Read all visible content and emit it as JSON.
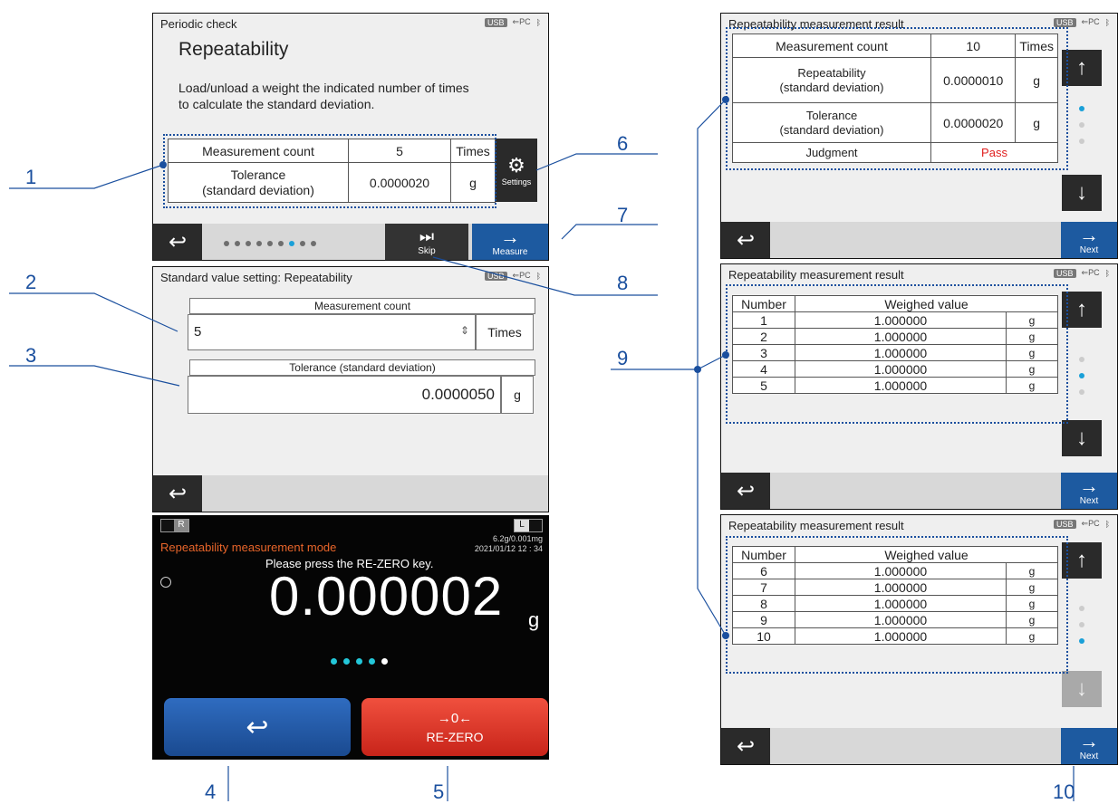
{
  "callouts": [
    "1",
    "2",
    "3",
    "4",
    "5",
    "6",
    "7",
    "8",
    "9",
    "10"
  ],
  "screen1": {
    "header": "Periodic check",
    "status": {
      "usb": "USB",
      "pc": "PC"
    },
    "title": "Repeatability",
    "desc_line1": "Load/unload a weight the indicated number of times",
    "desc_line2": "to calculate the standard deviation.",
    "rows": [
      {
        "label": "Measurement count",
        "value": "5",
        "unit": "Times"
      },
      {
        "label": "Tolerance\n(standard deviation)",
        "value": "0.0000020",
        "unit": "g"
      }
    ],
    "settings_label": "Settings",
    "skip_label": "Skip",
    "measure_label": "Measure"
  },
  "screen2": {
    "header": "Standard value setting: Repeatability",
    "count_label": "Measurement count",
    "count_value": "5",
    "count_unit": "Times",
    "tol_label": "Tolerance (standard deviation)",
    "tol_value": "0.0000050",
    "tol_unit": "g"
  },
  "screen3": {
    "left_tag": "R",
    "right_tag": "L",
    "mode": "Repeatability measurement mode",
    "capacity": "6.2g/0.001mg",
    "datetime": "2021/01/12  12 : 34",
    "prompt": "Please press the RE-ZERO key.",
    "reading": "0.000002",
    "unit": "g",
    "rezero_symbol": "→0←",
    "rezero_label": "RE-ZERO"
  },
  "result1": {
    "header": "Repeatability measurement result",
    "rows": [
      {
        "label": "Measurement count",
        "value": "10",
        "unit": "Times"
      },
      {
        "label": "Repeatability\n(standard deviation)",
        "value": "0.0000010",
        "unit": "g"
      },
      {
        "label": "Tolerance\n(standard deviation)",
        "value": "0.0000020",
        "unit": "g"
      },
      {
        "label": "Judgment",
        "value": "Pass",
        "unit": ""
      }
    ],
    "next_label": "Next"
  },
  "result2": {
    "header": "Repeatability measurement result",
    "col_number": "Number",
    "col_value": "Weighed value",
    "rows": [
      {
        "n": "1",
        "v": "1.000000",
        "u": "g"
      },
      {
        "n": "2",
        "v": "1.000000",
        "u": "g"
      },
      {
        "n": "3",
        "v": "1.000000",
        "u": "g"
      },
      {
        "n": "4",
        "v": "1.000000",
        "u": "g"
      },
      {
        "n": "5",
        "v": "1.000000",
        "u": "g"
      }
    ],
    "next_label": "Next"
  },
  "result3": {
    "header": "Repeatability measurement result",
    "col_number": "Number",
    "col_value": "Weighed value",
    "rows": [
      {
        "n": "6",
        "v": "1.000000",
        "u": "g"
      },
      {
        "n": "7",
        "v": "1.000000",
        "u": "g"
      },
      {
        "n": "8",
        "v": "1.000000",
        "u": "g"
      },
      {
        "n": "9",
        "v": "1.000000",
        "u": "g"
      },
      {
        "n": "10",
        "v": "1.000000",
        "u": "g"
      }
    ],
    "next_label": "Next"
  },
  "colors": {
    "accent": "#1d5aa0",
    "callout": "#1a4f9e",
    "pass": "#e02020",
    "rezero": "#e8382e",
    "mode_text": "#e8652a"
  }
}
